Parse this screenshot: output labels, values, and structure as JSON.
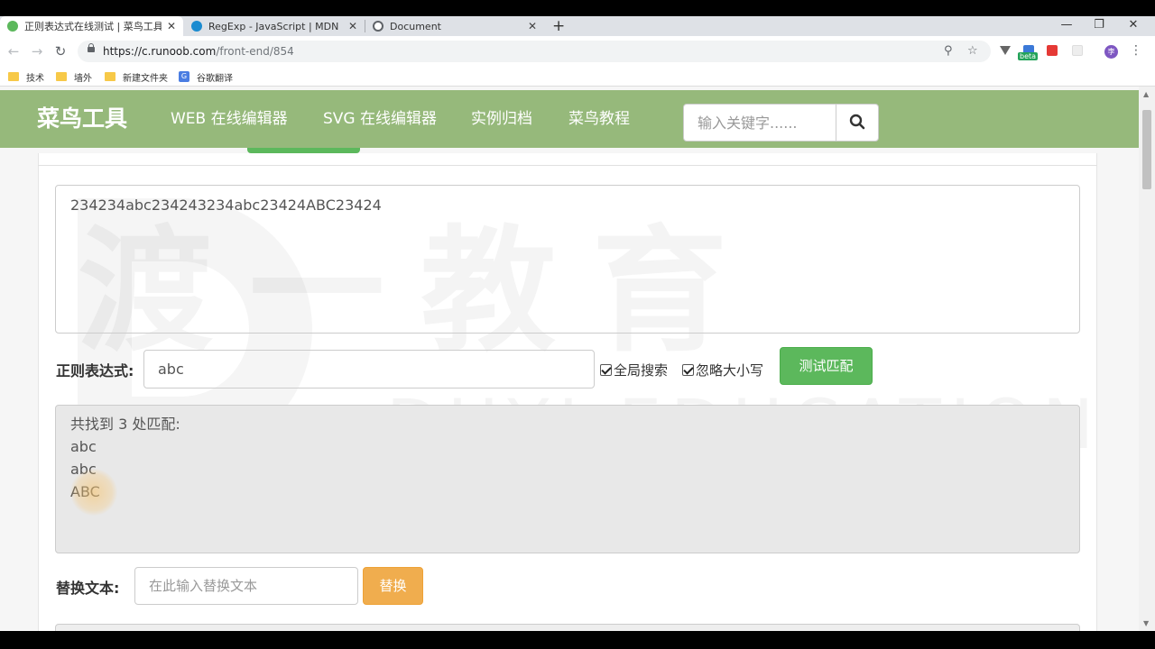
{
  "browser": {
    "tabs": [
      {
        "label": "正则表达式在线测试 | 菜鸟工具",
        "favicon_color": "#5cb85c",
        "active": true
      },
      {
        "label": "RegExp - JavaScript | MDN",
        "favicon_color": "#1b8bd0",
        "active": false
      },
      {
        "label": "Document",
        "favicon_color": "#5f6368",
        "active": false
      }
    ],
    "new_tab": "+",
    "window_controls": {
      "minimize": "—",
      "maximize": "❐",
      "close": "✕"
    },
    "url_host": "https://c.runoob.com",
    "url_path": "/front-end/854",
    "beta_badge": "beta",
    "profile_initial": "李",
    "bookmarks": [
      "技术",
      "墙外",
      "新建文件夹",
      "谷歌翻译"
    ],
    "google_translate_icon": "G"
  },
  "site": {
    "logo": "菜鸟工具",
    "nav": [
      "WEB 在线编辑器",
      "SVG 在线编辑器",
      "实例归档",
      "菜鸟教程"
    ],
    "search_placeholder": "输入关键字......"
  },
  "watermark": {
    "main": "渡一教育",
    "sub": "DUYI EDUCATION"
  },
  "tester": {
    "source_text": "234234abc234243234abc23424ABC23424",
    "regex_label": "正则表达式:",
    "regex_value": "abc",
    "global_label": "全局搜索",
    "ignore_case_label": "忽略大小写",
    "test_button": "测试匹配",
    "result_lines": [
      "共找到 3 处匹配:",
      "abc",
      "abc",
      "ABC"
    ],
    "replace_label": "替换文本:",
    "replace_placeholder": "在此输入替换文本",
    "replace_button": "替换"
  },
  "colors": {
    "nav_green": "#96b97b",
    "button_green": "#5cb85c",
    "button_orange": "#f0ad4e"
  }
}
